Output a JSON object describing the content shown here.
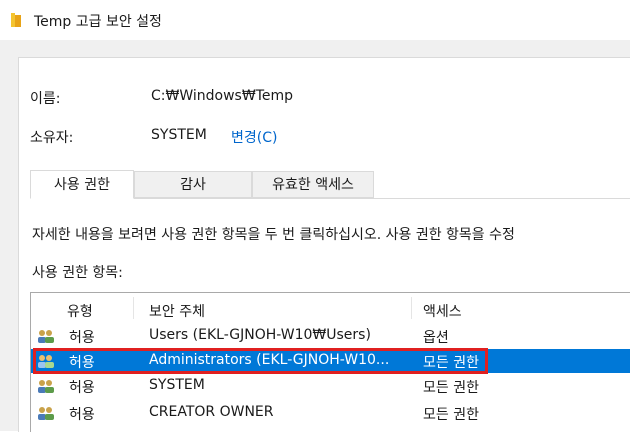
{
  "window": {
    "title": "Temp 고급 보안 설정"
  },
  "info": {
    "name_label": "이름:",
    "name_value": "C:₩Windows₩Temp",
    "owner_label": "소유자:",
    "owner_value": "SYSTEM",
    "owner_change_link": "변경(C)"
  },
  "tabs": [
    {
      "label": "사용 권한",
      "active": true
    },
    {
      "label": "감사",
      "active": false
    },
    {
      "label": "유효한 액세스",
      "active": false
    }
  ],
  "instruction": "자세한 내용을 보려면 사용 권한 항목을 두 번 클릭하십시오. 사용 권한 항목을 수정",
  "entries_label": "사용 권한 항목:",
  "table": {
    "columns": [
      "유형",
      "보안 주체",
      "액세스"
    ],
    "rows": [
      {
        "type": "허용",
        "principal": "Users (EKL-GJNOH-W10₩Users)",
        "access": "옵션",
        "selected": false
      },
      {
        "type": "허용",
        "principal": "Administrators (EKL-GJNOH-W10...",
        "access": "모든 권한",
        "selected": true
      },
      {
        "type": "허용",
        "principal": "SYSTEM",
        "access": "모든 권한",
        "selected": false
      },
      {
        "type": "허용",
        "principal": "CREATOR OWNER",
        "access": "모든 권한",
        "selected": false
      }
    ]
  },
  "colors": {
    "selection": "#0078d7",
    "highlight_border": "#e02020",
    "link": "#0066cc"
  },
  "icons": {
    "title": "folder-icon",
    "row": "user-group-icon"
  }
}
